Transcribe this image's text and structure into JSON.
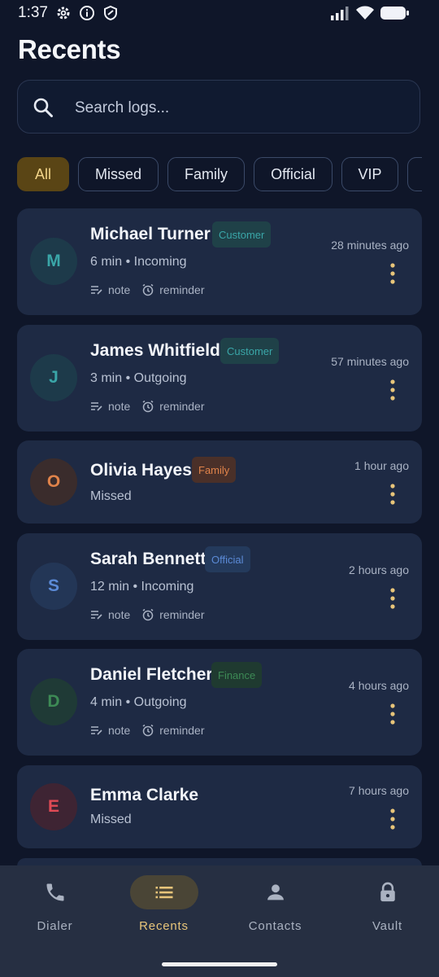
{
  "status_bar": {
    "time": "1:37"
  },
  "header": {
    "title": "Recents"
  },
  "search": {
    "placeholder": "Search logs..."
  },
  "filters": [
    {
      "label": "All",
      "active": true
    },
    {
      "label": "Missed",
      "active": false
    },
    {
      "label": "Family",
      "active": false
    },
    {
      "label": "Official",
      "active": false
    },
    {
      "label": "VIP",
      "active": false
    }
  ],
  "calls": [
    {
      "initial": "M",
      "name": "Michael Turner",
      "tag": "Customer",
      "detail": "6 min • Incoming",
      "time": "28 minutes ago",
      "note": "note",
      "reminder": "reminder"
    },
    {
      "initial": "J",
      "name": "James Whitfield",
      "tag": "Customer",
      "detail": "3 min • Outgoing",
      "time": "57 minutes ago",
      "note": "note",
      "reminder": "reminder"
    },
    {
      "initial": "O",
      "name": "Olivia Hayes",
      "tag": "Family",
      "detail": "Missed",
      "time": "1 hour ago"
    },
    {
      "initial": "S",
      "name": "Sarah Bennett",
      "tag": "Official",
      "detail": "12 min • Incoming",
      "time": "2 hours ago",
      "note": "note",
      "reminder": "reminder"
    },
    {
      "initial": "D",
      "name": "Daniel Fletcher",
      "tag": "Finance",
      "detail": "4 min • Outgoing",
      "time": "4 hours ago",
      "note": "note",
      "reminder": "reminder"
    },
    {
      "initial": "E",
      "name": "Emma Clarke",
      "detail": "Missed",
      "time": "7 hours ago"
    }
  ],
  "nav": [
    {
      "label": "Dialer",
      "icon": "phone-icon",
      "active": false
    },
    {
      "label": "Recents",
      "icon": "list-icon",
      "active": true
    },
    {
      "label": "Contacts",
      "icon": "person-icon",
      "active": false
    },
    {
      "label": "Vault",
      "icon": "lock-icon",
      "active": false
    }
  ],
  "colors": {
    "background": "#0f1629",
    "card": "#1e2a44",
    "accent": "#e8c57a",
    "customer": "#3aa6a8",
    "family": "#e0834a",
    "official": "#5b8ad6",
    "finance": "#3d8a55",
    "missed_red": "#e04a55"
  }
}
